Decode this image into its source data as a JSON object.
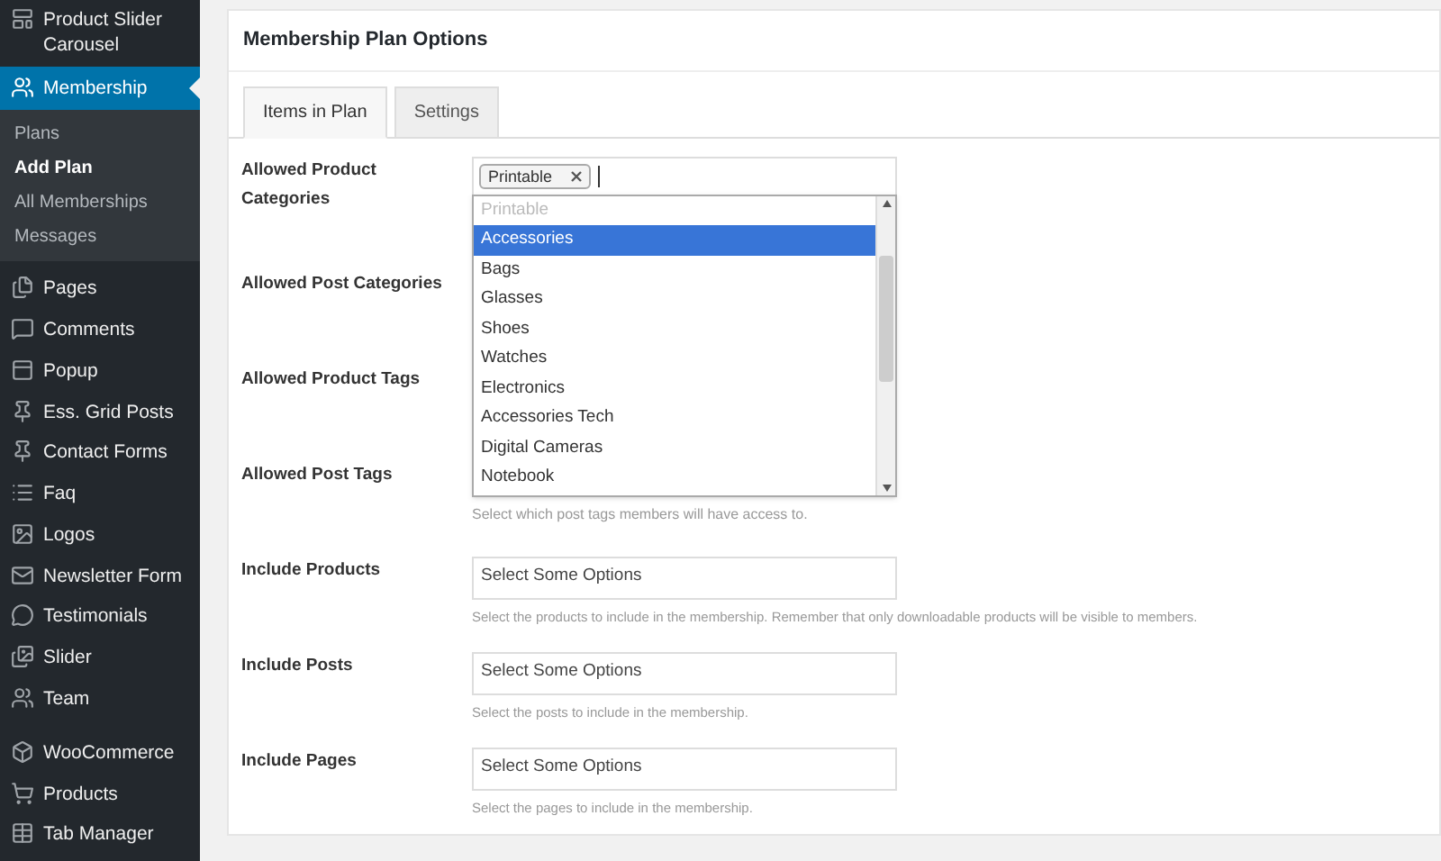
{
  "sidebar": {
    "groups": [
      [
        {
          "label": "Product Slider Carousel",
          "selected": false
        },
        {
          "label": "Membership",
          "selected": true,
          "children": [
            {
              "label": "Plans",
              "selected": false
            },
            {
              "label": "Add Plan",
              "selected": true
            },
            {
              "label": "All Memberships",
              "selected": false
            },
            {
              "label": "Messages",
              "selected": false
            }
          ]
        },
        {
          "label": "Pages",
          "selected": false
        },
        {
          "label": "Comments",
          "selected": false
        },
        {
          "label": "Popup",
          "selected": false
        },
        {
          "label": "Ess. Grid Posts",
          "selected": false
        },
        {
          "label": "Contact Forms",
          "selected": false
        },
        {
          "label": "Faq",
          "selected": false
        },
        {
          "label": "Logos",
          "selected": false
        },
        {
          "label": "Newsletter Form",
          "selected": false
        },
        {
          "label": "Testimonials",
          "selected": false
        },
        {
          "label": "Slider",
          "selected": false
        },
        {
          "label": "Team",
          "selected": false
        }
      ],
      [
        {
          "label": "WooCommerce",
          "selected": false
        },
        {
          "label": "Products",
          "selected": false
        },
        {
          "label": "Tab Manager",
          "selected": false
        }
      ]
    ]
  },
  "panel": {
    "title": "Membership Plan Options",
    "tabs": [
      {
        "label": "Items in Plan",
        "selected": true
      },
      {
        "label": "Settings",
        "selected": false
      }
    ],
    "rows": [
      {
        "label": "Allowed Product Categories",
        "kind": "tags",
        "tags": [
          "Printable"
        ],
        "dropdown": [
          {
            "label": "Printable",
            "disabled": true,
            "selected": false
          },
          {
            "label": "Accessories",
            "disabled": false,
            "selected": true
          },
          {
            "label": "Bags",
            "disabled": false,
            "selected": false
          },
          {
            "label": "Glasses",
            "disabled": false,
            "selected": false
          },
          {
            "label": "Shoes",
            "disabled": false,
            "selected": false
          },
          {
            "label": "Watches",
            "disabled": false,
            "selected": false
          },
          {
            "label": "Electronics",
            "disabled": false,
            "selected": false
          },
          {
            "label": "Accessories Tech",
            "disabled": false,
            "selected": false
          },
          {
            "label": "Digital Cameras",
            "disabled": false,
            "selected": false
          },
          {
            "label": "Notebook",
            "disabled": false,
            "selected": false
          }
        ]
      },
      {
        "label": "Allowed Post Categories",
        "kind": "covered"
      },
      {
        "label": "Allowed Product Tags",
        "kind": "covered"
      },
      {
        "label": "Allowed Post Tags",
        "kind": "covered",
        "help": "Select which post tags members will have access to."
      },
      {
        "label": "Include Products",
        "kind": "select",
        "placeholder": "Select Some Options",
        "help": "Select the products to include in the membership. Remember that only downloadable products will be visible to members."
      },
      {
        "label": "Include Posts",
        "kind": "select",
        "placeholder": "Select Some Options",
        "help": "Select the posts to include in the membership."
      },
      {
        "label": "Include Pages",
        "kind": "select",
        "placeholder": "Select Some Options",
        "help": "Select the pages to include in the membership."
      }
    ]
  }
}
